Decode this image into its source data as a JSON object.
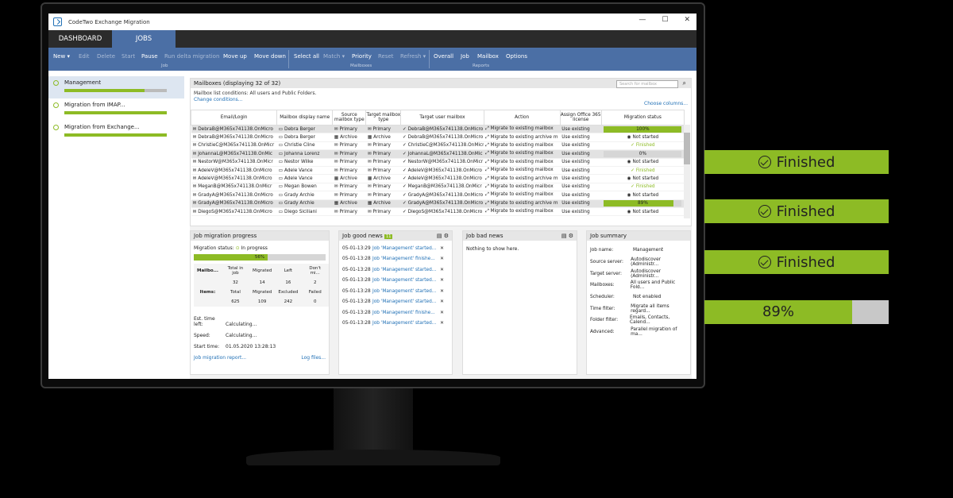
{
  "window": {
    "title": "CodeTwo Exchange Migration",
    "controls": [
      "—",
      "☐",
      "✕"
    ]
  },
  "tabs": [
    "DASHBOARD",
    "JOBS"
  ],
  "ribbon": {
    "job": [
      "New ▾",
      "Edit",
      "Delete",
      "Start",
      "Pause",
      "Run delta migration",
      "Move up",
      "Move down"
    ],
    "mailboxes": [
      "Select all",
      "Match ▾",
      "Priority",
      "Reset",
      "Refresh ▾"
    ],
    "reports": [
      "Overall",
      "Job",
      "Mailbox",
      "Options"
    ],
    "groups": [
      "Job",
      "Mailboxes",
      "Reports"
    ]
  },
  "sidebar": [
    {
      "label": "Management",
      "progress": 0.78
    },
    {
      "label": "Migration from IMAP...",
      "progress": 1.0
    },
    {
      "label": "Migration from Exchange...",
      "progress": 1.0
    }
  ],
  "mailboxes": {
    "title": "Mailboxes (displaying 32 of 32)",
    "search_placeholder": "Search for mailbox",
    "conditions": "Mailbox list conditions: All users and Public Folders.",
    "change": "Change conditions...",
    "choose": "Choose columns...",
    "columns": [
      "Email/Login",
      "Mailbox display name",
      "Source mailbox type",
      "Target mailbox type",
      "Target user mailbox",
      "Action",
      "Assign Office 365 license",
      "Migration status"
    ],
    "rows": [
      {
        "email": "DebraB@M365x741138.OnMicro",
        "name": "Debra Berger",
        "src": "Primary",
        "tgt": "Primary",
        "user": "DebraB@M365x741138.OnMicro",
        "action": "Migrate to existing mailbox",
        "lic": "Use existing",
        "status": "100%",
        "pct": 1.0,
        "hl": true
      },
      {
        "email": "DebraB@M365x741138.OnMicro",
        "name": "Debra Berger",
        "src": "Archive",
        "tgt": "Archive",
        "user": "DebraB@M365x741138.OnMicro",
        "action": "Migrate to existing archive m",
        "lic": "Use existing",
        "status": "Not started"
      },
      {
        "email": "ChristieC@M365x741138.OnMicr",
        "name": "Christie Cline",
        "src": "Primary",
        "tgt": "Primary",
        "user": "ChristieC@M365x741138.OnMicr",
        "action": "Migrate to existing mailbox",
        "lic": "Use existing",
        "status": "Finished"
      },
      {
        "email": "JohannaL@M365x741138.OnMic",
        "name": "Johanna Lorenz",
        "src": "Primary",
        "tgt": "Primary",
        "user": "JohannaL@M365x741138.OnMic",
        "action": "Migrate to existing mailbox",
        "lic": "Use existing",
        "status": "0%",
        "pct": 0.0,
        "hl": true
      },
      {
        "email": "NestorW@M365x741138.OnMicr",
        "name": "Nestor Wilke",
        "src": "Primary",
        "tgt": "Primary",
        "user": "NestorW@M365x741138.OnMicr",
        "action": "Migrate to existing mailbox",
        "lic": "Use existing",
        "status": "Not started"
      },
      {
        "email": "AdeleV@M365x741138.OnMicro",
        "name": "Adele Vance",
        "src": "Primary",
        "tgt": "Primary",
        "user": "AdeleV@M365x741138.OnMicro",
        "action": "Migrate to existing mailbox",
        "lic": "Use existing",
        "status": "Finished"
      },
      {
        "email": "AdeleV@M365x741138.OnMicro",
        "name": "Adele Vance",
        "src": "Archive",
        "tgt": "Archive",
        "user": "AdeleV@M365x741138.OnMicro",
        "action": "Migrate to existing archive m",
        "lic": "Use existing",
        "status": "Not started"
      },
      {
        "email": "MeganB@M365x741138.OnMicr",
        "name": "Megan Bowen",
        "src": "Primary",
        "tgt": "Primary",
        "user": "MeganB@M365x741138.OnMicr",
        "action": "Migrate to existing mailbox",
        "lic": "Use existing",
        "status": "Finished"
      },
      {
        "email": "GradyA@M365x741138.OnMicro",
        "name": "Grady Archie",
        "src": "Primary",
        "tgt": "Primary",
        "user": "GradyA@M365x741138.OnMicro",
        "action": "Migrate to existing mailbox",
        "lic": "Use existing",
        "status": "Not started"
      },
      {
        "email": "GradyA@M365x741138.OnMicro",
        "name": "Grady Archie",
        "src": "Archive",
        "tgt": "Archive",
        "user": "GradyA@M365x741138.OnMicro",
        "action": "Migrate to existing archive m",
        "lic": "Use existing",
        "status": "89%",
        "pct": 0.89,
        "hl": true
      },
      {
        "email": "DiegoS@M365x741138.OnMicro",
        "name": "Diego Siciliani",
        "src": "Primary",
        "tgt": "Primary",
        "user": "DiegoS@M365x741138.OnMicro",
        "action": "Migrate to existing mailbox",
        "lic": "Use existing",
        "status": "Not started"
      }
    ]
  },
  "progress": {
    "title": "Job migration progress",
    "status_label": "Migration status:",
    "status": "In progress",
    "pct_label": "56%",
    "pct": 0.56,
    "mb_headers": [
      "Mailbo...",
      "Total in job",
      "Migrated",
      "Left",
      "Don't mi..."
    ],
    "mb_values": [
      "",
      "32",
      "14",
      "16",
      "2"
    ],
    "it_headers": [
      "Items:",
      "Total",
      "Migrated",
      "Excluded",
      "Failed"
    ],
    "it_values": [
      "",
      "625",
      "109",
      "242",
      "0"
    ],
    "est": "Est. time left:",
    "est_v": "Calculating...",
    "speed": "Speed:",
    "speed_v": "Calculating...",
    "start": "Start time:",
    "start_v": "01.05.2020 13:28:13",
    "report": "Job migration report...",
    "logs": "Log files..."
  },
  "good": {
    "title": "Job good news",
    "count": "11",
    "items": [
      {
        "t": "05-01-13:29",
        "m": "Job 'Management' started..."
      },
      {
        "t": "05-01-13:28",
        "m": "Job 'Management' finishe..."
      },
      {
        "t": "05-01-13:28",
        "m": "Job 'Management' started..."
      },
      {
        "t": "05-01-13:28",
        "m": "Job 'Management' started..."
      },
      {
        "t": "05-01-13:28",
        "m": "Job 'Management' started..."
      },
      {
        "t": "05-01-13:28",
        "m": "Job 'Management' started..."
      },
      {
        "t": "05-01-13:28",
        "m": "Job 'Management' finishe..."
      },
      {
        "t": "05-01-13:28",
        "m": "Job 'Management' started..."
      }
    ]
  },
  "bad": {
    "title": "Job bad news",
    "empty": "Nothing to show here."
  },
  "summary": {
    "title": "Job summary",
    "rows": [
      {
        "k": "Job name:",
        "v": "Management"
      },
      {
        "k": "Source server:",
        "v": "Autodiscover (Administr..."
      },
      {
        "k": "Target server:",
        "v": "Autodiscover (Administr..."
      },
      {
        "k": "Mailboxes:",
        "v": "All users and Public Fold..."
      },
      {
        "k": "Scheduler:",
        "v": "Not enabled"
      },
      {
        "k": "Time filter:",
        "v": "Migrate all items regard..."
      },
      {
        "k": "Folder filter:",
        "v": "Emails, Contacts, Calend..."
      },
      {
        "k": "Advanced:",
        "v": "Parallel migration of ma..."
      }
    ]
  },
  "badges": [
    {
      "label": "Finished"
    },
    {
      "label": "Finished"
    },
    {
      "label": "Finished"
    },
    {
      "label": "89%",
      "pct": 0.8
    }
  ],
  "colors": {
    "accent": "#4b6fa5",
    "green": "#8dbb25"
  }
}
